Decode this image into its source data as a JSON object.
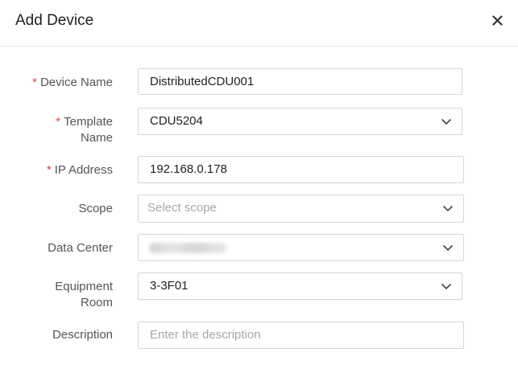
{
  "dialog": {
    "title": "Add Device",
    "close_symbol": "×"
  },
  "form": {
    "required_mark": "*",
    "device_name": {
      "label": "Device Name",
      "value": "DistributedCDU001"
    },
    "template_name": {
      "label_line1": "Template",
      "label_line2": "Name",
      "value": "CDU5204"
    },
    "ip_address": {
      "label": "IP Address",
      "value": "192.168.0.178"
    },
    "scope": {
      "label": "Scope",
      "placeholder": "Select scope"
    },
    "data_center": {
      "label": "Data Center",
      "value_note": "blurred value"
    },
    "equipment_room": {
      "label_line1": "Equipment",
      "label_line2": "Room",
      "value": "3-3F01"
    },
    "description": {
      "label": "Description",
      "placeholder": "Enter the description"
    }
  },
  "icons": {
    "close": "close-icon",
    "dropdown": "chevron-down-icon"
  },
  "colors": {
    "required": "#e0443e",
    "border": "#d6d6d6",
    "placeholder": "#a8a8a8"
  }
}
